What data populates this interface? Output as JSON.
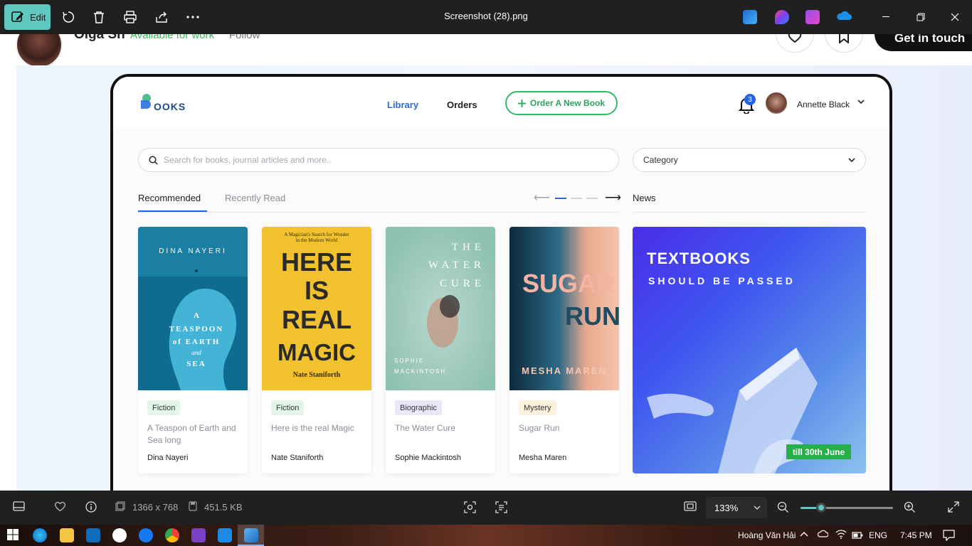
{
  "viewer": {
    "edit_label": "Edit",
    "file_title": "Screenshot (28).png",
    "dimensions": "1366 x 768",
    "file_size": "451.5 KB",
    "zoom": "133%",
    "zoom_level": 0.22
  },
  "page": {
    "owner_name": "Olga Sh",
    "owner_status": "Available for work",
    "follow_label": "Follow",
    "get_in_touch": "Get in touch"
  },
  "app": {
    "logo_text": "OOKS",
    "nav": {
      "library": "Library",
      "orders": "Orders"
    },
    "order_button": "Order A New Book",
    "notifications": "3",
    "user_name": "Annette Black",
    "search_placeholder": "Search for books, journal articles and more..",
    "category_label": "Category",
    "tabs": {
      "recommended": "Recommended",
      "recently_read": "Recently Read"
    },
    "news_label": "News",
    "books": [
      {
        "genre": "Fiction",
        "title": "A Teaspon of Earth and Sea long",
        "author": "Dina Nayeri",
        "badge_color": "#e4f6e9"
      },
      {
        "genre": "Fiction",
        "title": "Here is the real Magic",
        "author": "Nate Staniforth",
        "badge_color": "#e4f6e9"
      },
      {
        "genre": "Biographic",
        "title": "The Water Cure",
        "author": "Sophie Mackintosh",
        "badge_color": "#ece6fb"
      },
      {
        "genre": "Mystery",
        "title": "Sugar Run",
        "author": "Mesha Maren",
        "badge_color": "#fdf0dc"
      }
    ],
    "covers": [
      {
        "lines": [
          "DINA NAYERI",
          "A",
          "TEASPOON",
          "of EARTH",
          "and",
          "SEA"
        ]
      },
      {
        "lines": [
          "A Magician's Search for Wonder",
          "in the Modern World",
          "HERE",
          "IS",
          "REAL",
          "MAGIC",
          "Nate Staniforth"
        ]
      },
      {
        "lines": [
          "THE",
          "WATER",
          "CURE",
          "SOPHIE",
          "MACKINTOSH"
        ]
      },
      {
        "lines": [
          "SUGAR",
          "RUN",
          "MESHA MAREN"
        ]
      }
    ],
    "news": {
      "headline": "TEXTBOOKS",
      "subline": "SHOULD BE PASSED",
      "deadline": "till 30th June"
    }
  },
  "taskbar": {
    "user": "Hoàng Văn Hải",
    "lang": "ENG",
    "time": "7:45 PM"
  },
  "colors": {
    "accent": "#5fc8c0",
    "brand_blue": "#2563eb",
    "green": "#35b86a"
  }
}
